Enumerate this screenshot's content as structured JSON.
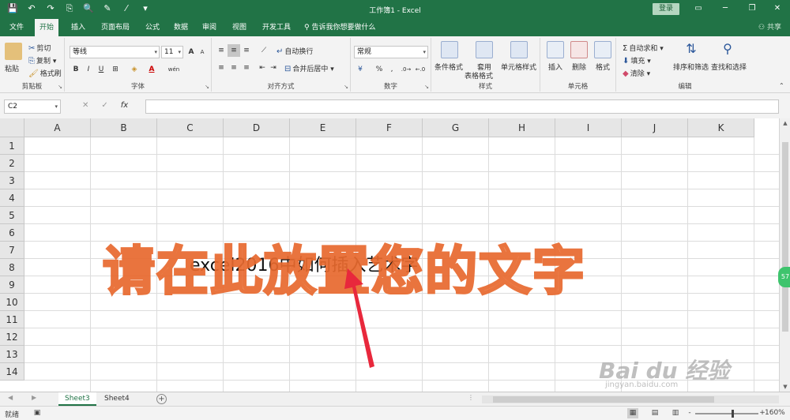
{
  "window": {
    "title": "工作簿1 - Excel",
    "login_label": "登录"
  },
  "qat": {
    "icons": [
      "save-icon",
      "undo-icon",
      "redo-icon",
      "copy-icon",
      "print-preview-icon",
      "paint-icon",
      "pen-icon",
      "customize-icon"
    ]
  },
  "tabs": [
    "文件",
    "开始",
    "插入",
    "页面布局",
    "公式",
    "数据",
    "审阅",
    "视图",
    "开发工具"
  ],
  "active_tab": "开始",
  "tell_me": "告诉我你想要做什么",
  "share_label": "共享",
  "ribbon": {
    "clipboard": {
      "group_label": "剪贴板",
      "paste": "粘贴",
      "cut": "剪切",
      "copy": "复制",
      "format_painter": "格式刷"
    },
    "font": {
      "group_label": "字体",
      "font_name": "等线",
      "font_size": "11",
      "bold": "B",
      "italic": "I",
      "underline": "U",
      "grow": "A",
      "shrink": "A",
      "font_color_letter": "A",
      "phonetic": "wén"
    },
    "alignment": {
      "group_label": "对齐方式",
      "wrap_text": "自动换行",
      "merge_center": "合并后居中"
    },
    "number": {
      "group_label": "数字",
      "format": "常规",
      "percent": "%",
      "comma": ","
    },
    "styles": {
      "group_label": "样式",
      "conditional": "条件格式",
      "table_format_line1": "套用",
      "table_format_line2": "表格格式",
      "cell_styles": "单元格样式"
    },
    "cells": {
      "group_label": "单元格",
      "insert": "插入",
      "delete": "删除",
      "format": "格式"
    },
    "editing": {
      "group_label": "编辑",
      "autosum": "自动求和",
      "fill": "填充",
      "clear": "清除",
      "sort_filter": "排序和筛选",
      "find_select": "查找和选择"
    }
  },
  "formula_bar": {
    "name_box": "C2",
    "cancel": "✕",
    "enter": "✓",
    "fx": "fx",
    "value": ""
  },
  "columns": [
    "A",
    "B",
    "C",
    "D",
    "E",
    "F",
    "G",
    "H",
    "I",
    "J",
    "K"
  ],
  "rows": [
    "1",
    "2",
    "3",
    "4",
    "5",
    "6",
    "7",
    "8",
    "9",
    "10",
    "11",
    "12",
    "13",
    "14"
  ],
  "cell_text": "excel2016中如何插入艺术字",
  "overlay_text": "请在此放置您的文字",
  "sheets": [
    "Sheet3",
    "Sheet4"
  ],
  "active_sheet": "Sheet3",
  "add_sheet": "+",
  "status": {
    "ready": "就绪",
    "zoom_minus": "-",
    "zoom_plus": "+",
    "zoom": "160%"
  },
  "side_badge": "57",
  "watermark": {
    "main": "Bai du 经验",
    "sub": "jingyan.baidu.com"
  },
  "colors": {
    "excel_green": "#217346",
    "overlay_fill": "#f6a276",
    "overlay_stroke": "#e8692e",
    "arrow": "#e8283c"
  }
}
